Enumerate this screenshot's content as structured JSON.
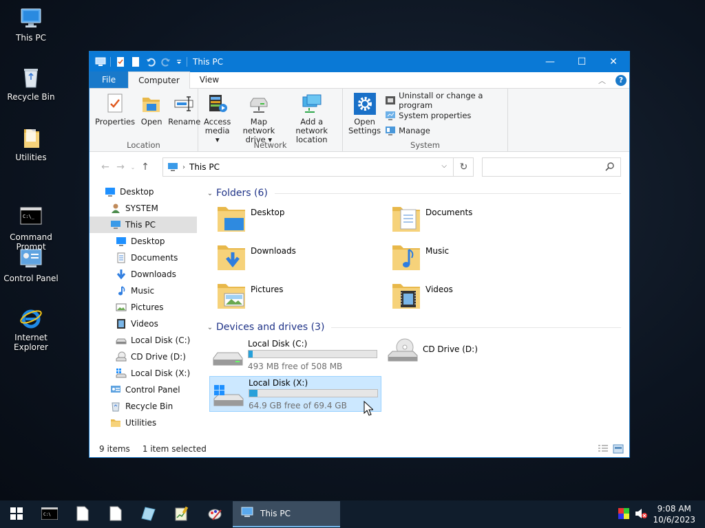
{
  "desktop": {
    "icons": [
      {
        "label": "This PC"
      },
      {
        "label": "Recycle Bin"
      },
      {
        "label": "Utilities"
      },
      {
        "label": "Command\nPrompt"
      },
      {
        "label": "Control Panel"
      },
      {
        "label": "Internet Explorer"
      }
    ]
  },
  "window": {
    "title": "This PC",
    "controls": {
      "minimize": "—",
      "maximize": "☐",
      "close": "✕"
    }
  },
  "menubar": {
    "tabs": [
      {
        "label": "File"
      },
      {
        "label": "Computer"
      },
      {
        "label": "View"
      }
    ]
  },
  "ribbon": {
    "groups": {
      "location": {
        "label": "Location",
        "buttons": [
          {
            "label": "Properties"
          },
          {
            "label": "Open"
          },
          {
            "label": "Rename"
          }
        ]
      },
      "network": {
        "label": "Network",
        "buttons": [
          {
            "label1": "Access",
            "label2": "media ▾"
          },
          {
            "label1": "Map network",
            "label2": "drive ▾"
          },
          {
            "label1": "Add a network",
            "label2": "location"
          }
        ]
      },
      "system": {
        "label": "System",
        "open_settings": {
          "label1": "Open",
          "label2": "Settings"
        },
        "items": [
          {
            "label": "Uninstall or change a program"
          },
          {
            "label": "System properties"
          },
          {
            "label": "Manage"
          }
        ]
      }
    }
  },
  "address": {
    "path": "This PC",
    "search_placeholder": ""
  },
  "nav": {
    "items": [
      {
        "label": "Desktop",
        "indent": 0,
        "icon": "desktop-icon"
      },
      {
        "label": "SYSTEM",
        "indent": 1,
        "icon": "user-icon"
      },
      {
        "label": "This PC",
        "indent": 1,
        "icon": "computer-icon",
        "selected": true
      },
      {
        "label": "Desktop",
        "indent": 2,
        "icon": "desktop-icon"
      },
      {
        "label": "Documents",
        "indent": 2,
        "icon": "documents-icon"
      },
      {
        "label": "Downloads",
        "indent": 2,
        "icon": "downloads-icon"
      },
      {
        "label": "Music",
        "indent": 2,
        "icon": "music-icon"
      },
      {
        "label": "Pictures",
        "indent": 2,
        "icon": "pictures-icon"
      },
      {
        "label": "Videos",
        "indent": 2,
        "icon": "videos-icon"
      },
      {
        "label": "Local Disk (C:)",
        "indent": 2,
        "icon": "drive-icon"
      },
      {
        "label": "CD Drive (D:)",
        "indent": 2,
        "icon": "cd-drive-icon"
      },
      {
        "label": "Local Disk (X:)",
        "indent": 2,
        "icon": "windows-drive-icon"
      },
      {
        "label": "Control Panel",
        "indent": 1,
        "icon": "control-panel-icon"
      },
      {
        "label": "Recycle Bin",
        "indent": 1,
        "icon": "recycle-bin-icon"
      },
      {
        "label": "Utilities",
        "indent": 1,
        "icon": "folder-icon"
      }
    ]
  },
  "content": {
    "folders_header": "Folders (6)",
    "folders": [
      {
        "label": "Desktop"
      },
      {
        "label": "Documents"
      },
      {
        "label": "Downloads"
      },
      {
        "label": "Music"
      },
      {
        "label": "Pictures"
      },
      {
        "label": "Videos"
      }
    ],
    "drives_header": "Devices and drives (3)",
    "drives": [
      {
        "label": "Local Disk (C:)",
        "free": "493 MB free of 508 MB",
        "used_fraction": 0.03
      },
      {
        "label": "CD Drive (D:)"
      },
      {
        "label": "Local Disk (X:)",
        "free": "64.9 GB free of 69.4 GB",
        "used_fraction": 0.065,
        "selected": true
      }
    ]
  },
  "status": {
    "count": "9 items",
    "selection": "1 item selected"
  },
  "taskbar": {
    "active_window": "This PC",
    "time": "9:08 AM",
    "date": "10/6/2023"
  },
  "colors": {
    "accent": "#0a79d6",
    "selection": "#cce8ff",
    "progress": "#26a0da"
  }
}
